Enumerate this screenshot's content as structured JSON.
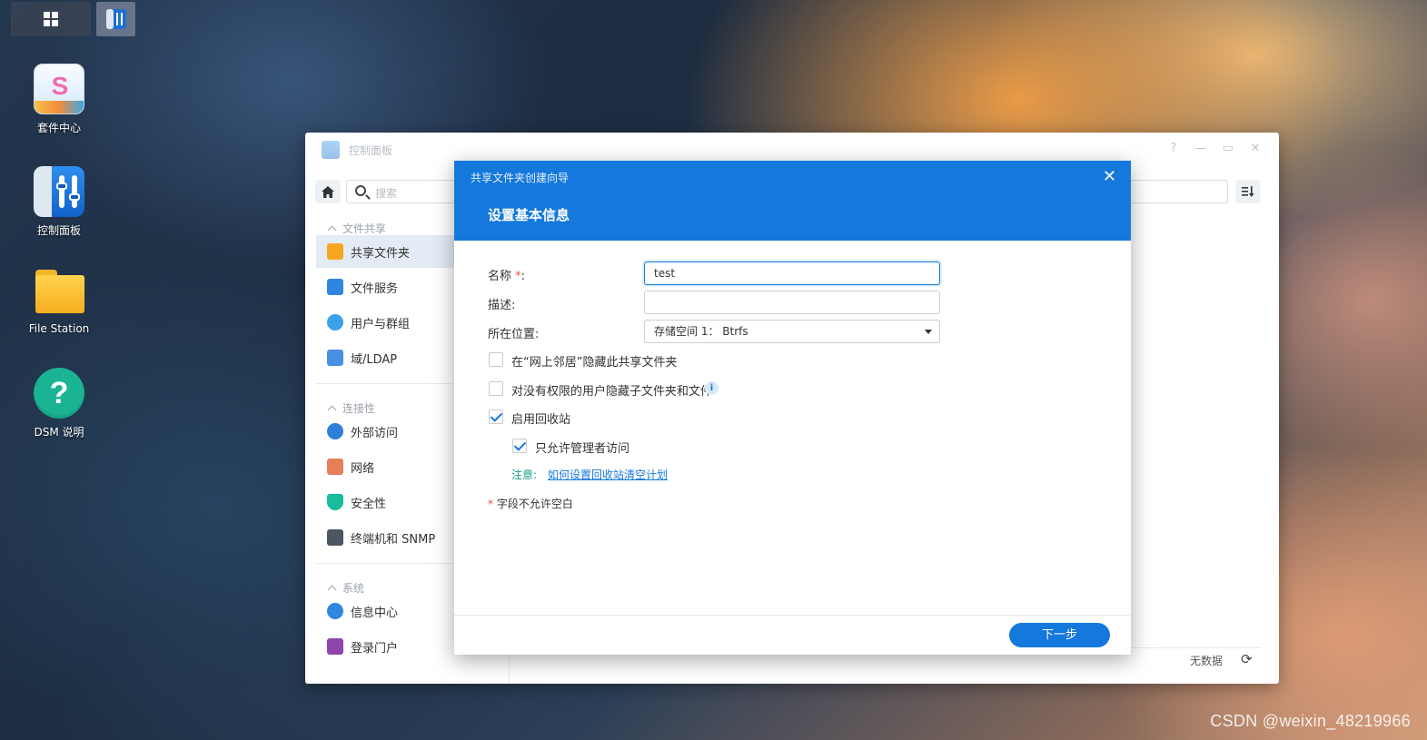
{
  "desktop": {
    "icons": [
      {
        "label": "套件中心",
        "icon": "package-center-icon"
      },
      {
        "label": "控制面板",
        "icon": "control-panel-icon"
      },
      {
        "label": "File Station",
        "icon": "file-station-icon"
      },
      {
        "label": "DSM 说明",
        "icon": "help-icon"
      }
    ],
    "watermark": "CSDN @weixin_48219966"
  },
  "control_panel": {
    "title": "控制面板",
    "search_placeholder": "搜索",
    "sections": [
      {
        "label": "文件共享",
        "items": [
          "共享文件夹",
          "文件服务",
          "用户与群组",
          "域/LDAP"
        ]
      },
      {
        "label": "连接性",
        "items": [
          "外部访问",
          "网络",
          "安全性",
          "终端机和 SNMP"
        ]
      },
      {
        "label": "系统",
        "items": [
          "信息中心",
          "登录门户"
        ]
      }
    ],
    "footer_status": "无数据"
  },
  "wizard": {
    "window_title": "共享文件夹创建向导",
    "heading": "设置基本信息",
    "fields": {
      "name_label": "名称",
      "name_value": "test",
      "description_label": "描述:",
      "description_value": "",
      "location_label": "所在位置:",
      "location_value": "存储空间 1： Btrfs"
    },
    "checkboxes": [
      {
        "label": "在“网上邻居”隐藏此共享文件夹",
        "checked": false
      },
      {
        "label": "对没有权限的用户隐藏子文件夹和文件",
        "checked": false
      },
      {
        "label": "启用回收站",
        "checked": true
      },
      {
        "label": "只允许管理者访问",
        "checked": true
      }
    ],
    "note_label": "注意:",
    "note_link": "如何设置回收站清空计划",
    "required_hint": "字段不允许空白",
    "next_button": "下一步",
    "accent_color": "#1478dc"
  }
}
